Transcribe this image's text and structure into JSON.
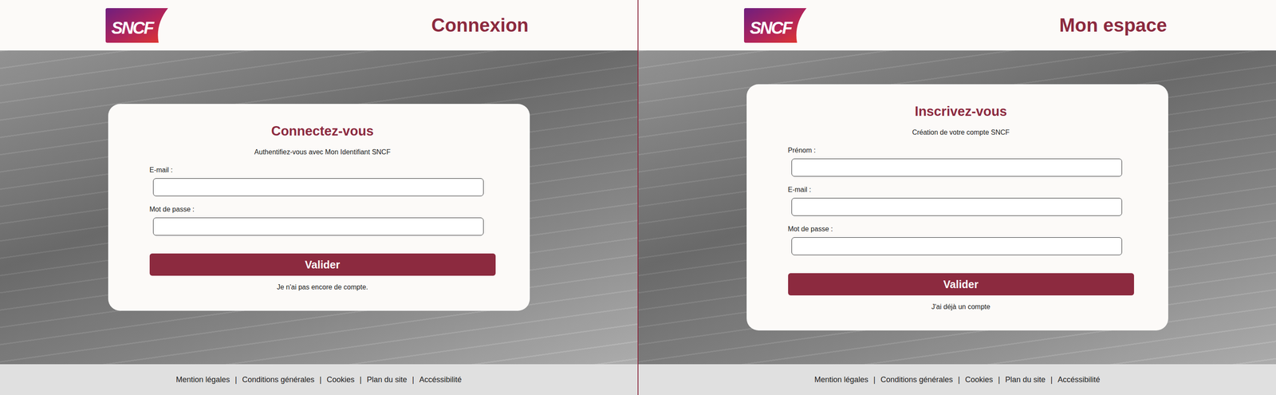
{
  "pages": [
    {
      "header": {
        "logo": "SNCF",
        "title": "Connexion"
      },
      "card": {
        "heading": "Connectez-vous",
        "subtitle": "Authentifiez-vous avec Mon Identifiant SNCF",
        "fields": [
          {
            "label": "E-mail :"
          },
          {
            "label": "Mot de passe :"
          }
        ],
        "button": "Valider",
        "link": "Je n'ai pas encore de compte."
      },
      "footer": {
        "links": [
          "Mention légales",
          "Conditions générales",
          "Cookies",
          "Plan du site",
          "Accéssibilité"
        ],
        "separator": "|"
      }
    },
    {
      "header": {
        "logo": "SNCF",
        "title": "Mon espace"
      },
      "card": {
        "heading": "Inscrivez-vous",
        "subtitle": "Création de votre compte SNCF",
        "fields": [
          {
            "label": "Prénom :"
          },
          {
            "label": "E-mail :"
          },
          {
            "label": "Mot de passe :"
          }
        ],
        "button": "Valider",
        "link": "J'ai déjà un compte"
      },
      "footer": {
        "links": [
          "Mention légales",
          "Conditions générales",
          "Cookies",
          "Plan du site",
          "Accéssibilité"
        ],
        "separator": "|"
      }
    }
  ]
}
